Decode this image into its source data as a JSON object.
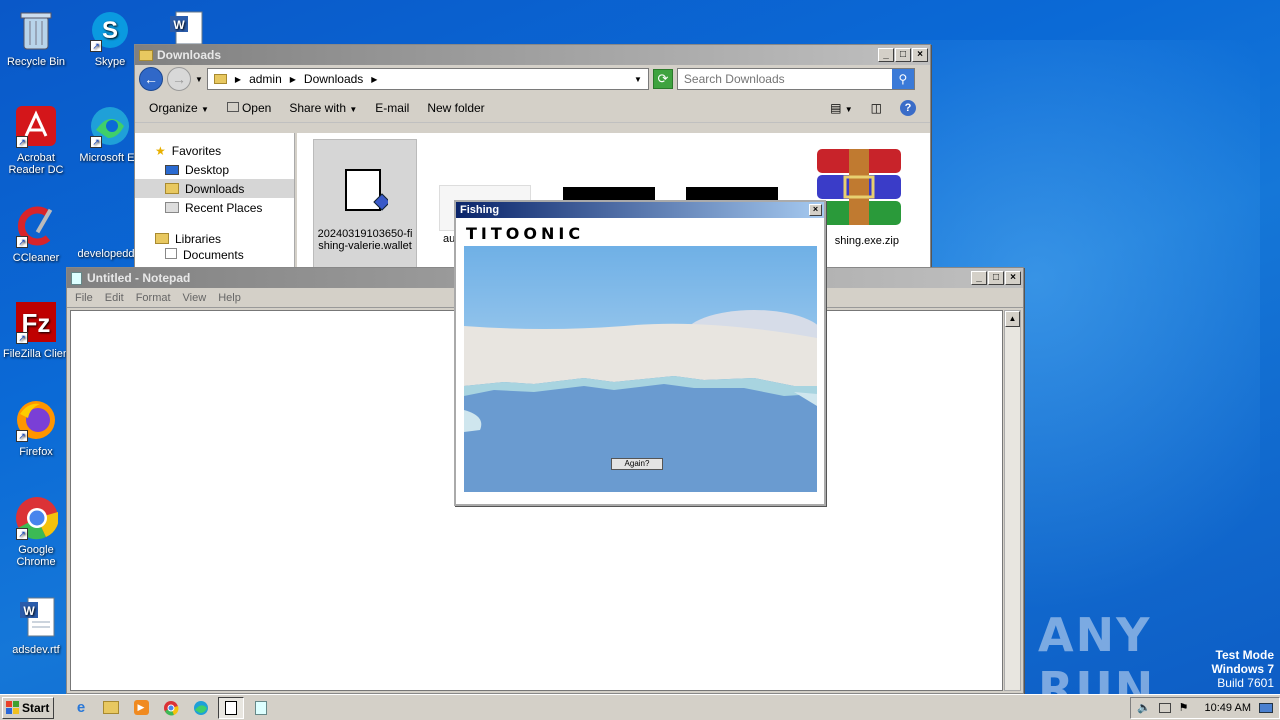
{
  "desktop": {
    "icons": [
      {
        "label": "Recycle Bin",
        "icon": "recycle-bin-icon"
      },
      {
        "label": "Skype",
        "icon": "skype-icon"
      },
      {
        "label": "Acrobat Reader DC",
        "icon": "acrobat-icon"
      },
      {
        "label": "Microsoft Ed",
        "icon": "edge-icon"
      },
      {
        "label": "CCleaner",
        "icon": "ccleaner-icon"
      },
      {
        "label": "developedd",
        "icon": "word-doc-icon"
      },
      {
        "label": "FileZilla Clien",
        "icon": "filezilla-icon"
      },
      {
        "label": "Firefox",
        "icon": "firefox-icon"
      },
      {
        "label": "Google Chrome",
        "icon": "chrome-icon"
      },
      {
        "label": "adsdev.rtf",
        "icon": "word-doc-icon"
      }
    ],
    "watermark": "ANY RUN",
    "test_mode": [
      "Test Mode",
      "Windows 7",
      "Build 7601"
    ]
  },
  "explorer": {
    "title": "Downloads",
    "breadcrumb": [
      "admin",
      "Downloads"
    ],
    "search_placeholder": "Search Downloads",
    "toolbar": [
      "Organize",
      "Open",
      "Share with",
      "E-mail",
      "New folder"
    ],
    "nav": {
      "favorites": "Favorites",
      "items": [
        "Desktop",
        "Downloads",
        "Recent Places"
      ],
      "libraries": "Libraries",
      "documents": "Documents"
    },
    "files": [
      {
        "name": "20240319103650-fishing-valerie.wallet",
        "line1": "20240319103650-fi",
        "line2": "shing-valerie.wallet"
      },
      {
        "name": "au",
        "line1": "au",
        "line2": ""
      },
      {
        "name": "fishing.exe.zip",
        "line1": "shing.exe.zip",
        "line2": ""
      }
    ]
  },
  "notepad": {
    "title": "Untitled - Notepad",
    "menu": [
      "File",
      "Edit",
      "Format",
      "View",
      "Help"
    ],
    "content": ""
  },
  "fishing": {
    "title": "Fishing",
    "logo": "TITOONIC",
    "button": "Again?"
  },
  "taskbar": {
    "start": "Start",
    "clock": "10:49 AM"
  },
  "colors": {
    "desktop": "#0b6ad6",
    "title_active": "#0a246a",
    "title_inactive": "#808080",
    "sky": "#9ccbee",
    "water": "#6b9fd4",
    "ice": "#e6e3de"
  }
}
